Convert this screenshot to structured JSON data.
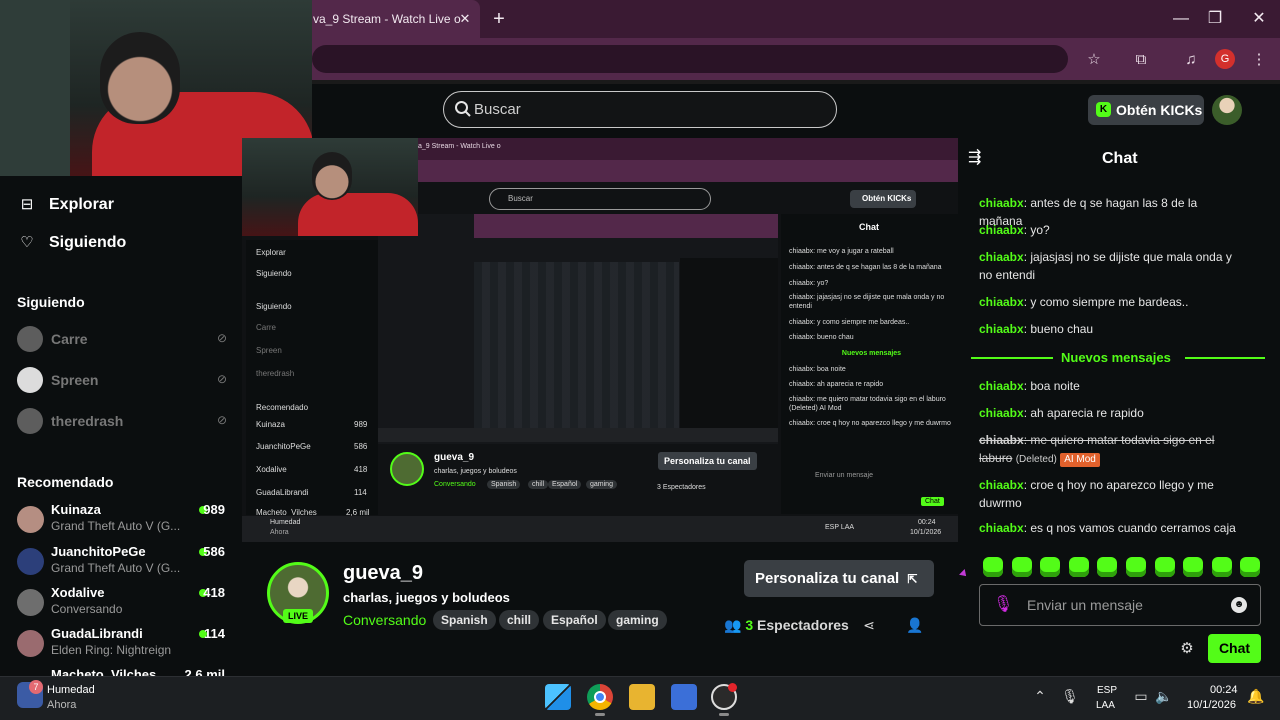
{
  "browser": {
    "tab_title": "va_9 Stream - Watch Live o",
    "tab_close": "✕",
    "new_tab": "+",
    "window": {
      "minimize": "—",
      "maximize": "❐",
      "close": "✕"
    },
    "profile_initial": "G"
  },
  "header": {
    "search_placeholder": "Buscar",
    "kicks_button": "Obtén KICKs",
    "kicks_icon": "K"
  },
  "sidebar": {
    "nav": [
      {
        "label": "Explorar",
        "icon": "compass-icon"
      },
      {
        "label": "Siguiendo",
        "icon": "heart-icon"
      }
    ],
    "following_title": "Siguiendo",
    "following": [
      {
        "name": "Carre",
        "status": "offline"
      },
      {
        "name": "Spreen",
        "status": "offline"
      },
      {
        "name": "theredrash",
        "status": "offline"
      }
    ],
    "recommended_title": "Recomendado",
    "recommended": [
      {
        "name": "Kuinaza",
        "game": "Grand Theft Auto V (G...",
        "viewers": "989"
      },
      {
        "name": "JuanchitoPeGe",
        "game": "Grand Theft Auto V (G...",
        "viewers": "586"
      },
      {
        "name": "Xodalive",
        "game": "Conversando",
        "viewers": "418"
      },
      {
        "name": "GuadaLibrandi",
        "game": "Elden Ring: Nightreign",
        "viewers": "114"
      },
      {
        "name": "Macheto_Vilches",
        "game": "",
        "viewers": "2,6 mil"
      }
    ]
  },
  "nested": {
    "tab": "a_9 Stream - Watch Live o",
    "search": "Buscar",
    "kicks": "Obtén KICKs",
    "side_items": [
      "Explorar",
      "Siguiendo",
      "Siguiendo",
      "Carre",
      "Spreen",
      "theredrash",
      "Recomendado",
      "Kuinaza",
      "JuanchitoPeGe",
      "Xodalive",
      "GuadaLibrandi",
      "Macheto_Vilches"
    ],
    "side_counts": [
      "989",
      "586",
      "418",
      "114",
      "2,6 mil"
    ],
    "chat_title": "Chat",
    "chat_lines": [
      "chiaabx: me voy a jugar a rateball",
      "chiaabx: antes de q se hagan las 8 de la mañana",
      "chiaabx: yo?",
      "chiaabx: jajasjasj no se dijiste que mala onda y no entendi",
      "chiaabx: y como siempre me bardeas..",
      "chiaabx: bueno chau",
      "Nuevos mensajes",
      "chiaabx: boa noite",
      "chiaabx: ah aparecia re rapido",
      "chiaabx: me quiero matar todavia sigo en el laburo (Deleted) AI Mod",
      "chiaabx: croe q hoy no aparezco llego y me duwrmo"
    ],
    "streamer": "gueva_9",
    "title": "charlas, juegos y boludeos",
    "category": "Conversando",
    "tags": [
      "Spanish",
      "chill",
      "Español",
      "gaming"
    ],
    "customize": "Personaliza tu canal",
    "viewers": "3 Espectadores",
    "chat_placeholder": "Enviar un mensaje",
    "chat_send": "Chat",
    "weather_title": "Humedad",
    "weather_sub": "Ahora",
    "lang": "ESP LAA",
    "time": "00:24",
    "date": "10/1/2026"
  },
  "stream_info": {
    "streamer": "gueva_9",
    "live_badge": "LIVE",
    "title": "charlas, juegos y boludeos",
    "category": "Conversando",
    "tags": [
      "Spanish",
      "chill",
      "Español",
      "gaming"
    ],
    "customize_button": "Personaliza tu canal",
    "customize_icon": "external-link-icon",
    "viewers_count": "3",
    "viewers_label": "Espectadores"
  },
  "chat": {
    "title": "Chat",
    "messages_before": [
      {
        "user": "chiaabx",
        "text": ": antes de q se hagan las 8 de la mañana"
      },
      {
        "user": "chiaabx",
        "text": ": yo?"
      },
      {
        "user": "chiaabx",
        "text": ": jajasjasj no se dijiste que mala onda y no entendi"
      },
      {
        "user": "chiaabx",
        "text": ": y como siempre me bardeas.."
      },
      {
        "user": "chiaabx",
        "text": ": bueno chau"
      }
    ],
    "new_messages_label": "Nuevos mensajes",
    "messages_after": [
      {
        "user": "chiaabx",
        "text": ": boa noite"
      },
      {
        "user": "chiaabx",
        "text": ": ah aparecia re rapido"
      },
      {
        "user": "chiaabx",
        "text": ": me quiero matar todavia sigo en el laburo",
        "deleted_tag": "(Deleted)",
        "mod_tag": "AI Mod"
      },
      {
        "user": "chiaabx",
        "text": ": croe q hoy no aparezco llego y me duwrmo"
      },
      {
        "user": "chiaabx",
        "text": ": es q nos vamos cuando cerramos caja"
      }
    ],
    "input_placeholder": "Enviar un mensaje",
    "send_button": "Chat",
    "emote_count": 10
  },
  "taskbar": {
    "weather_title": "Humedad",
    "weather_sub": "Ahora",
    "weather_badge": "7",
    "lang_line1": "ESP",
    "lang_line2": "LAA",
    "time": "00:24",
    "date": "10/1/2026"
  },
  "colors": {
    "accent": "#53fc18",
    "browser_frame": "#53284a",
    "background": "#0b0e0f",
    "mod_tag": "#e1612c"
  }
}
